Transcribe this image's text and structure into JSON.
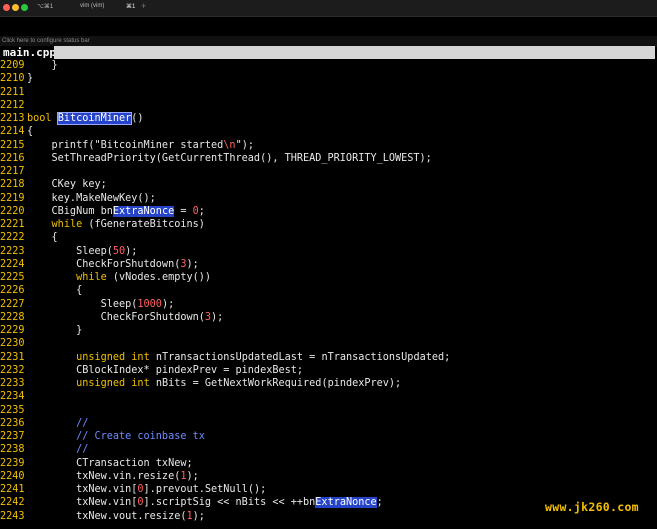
{
  "window": {
    "tab_left": "⌥⌘1",
    "tab_title": "vim (vim)",
    "tab_shortcut": "⌘1",
    "new_tab": "+"
  },
  "status_bar": {
    "hint": "Click here to configure status bar"
  },
  "file_tab": {
    "name": "main.cpp"
  },
  "editor": {
    "lines": [
      {
        "n": "2209",
        "code": "    }"
      },
      {
        "n": "2210",
        "code": "}"
      },
      {
        "n": "2211",
        "code": ""
      },
      {
        "n": "2212",
        "code": ""
      },
      {
        "n": "2213",
        "code": "bool BitcoinMiner()"
      },
      {
        "n": "2214",
        "code": "{"
      },
      {
        "n": "2215",
        "code": "    printf(\"BitcoinMiner started\\n\");"
      },
      {
        "n": "2216",
        "code": "    SetThreadPriority(GetCurrentThread(), THREAD_PRIORITY_LOWEST);"
      },
      {
        "n": "2217",
        "code": ""
      },
      {
        "n": "2218",
        "code": "    CKey key;"
      },
      {
        "n": "2219",
        "code": "    key.MakeNewKey();"
      },
      {
        "n": "2220",
        "code": "    CBigNum bnExtraNonce = 0;"
      },
      {
        "n": "2221",
        "code": "    while (fGenerateBitcoins)"
      },
      {
        "n": "2222",
        "code": "    {"
      },
      {
        "n": "2223",
        "code": "        Sleep(50);"
      },
      {
        "n": "2224",
        "code": "        CheckForShutdown(3);"
      },
      {
        "n": "2225",
        "code": "        while (vNodes.empty())"
      },
      {
        "n": "2226",
        "code": "        {"
      },
      {
        "n": "2227",
        "code": "            Sleep(1000);"
      },
      {
        "n": "2228",
        "code": "            CheckForShutdown(3);"
      },
      {
        "n": "2229",
        "code": "        }"
      },
      {
        "n": "2230",
        "code": ""
      },
      {
        "n": "2231",
        "code": "        unsigned int nTransactionsUpdatedLast = nTransactionsUpdated;"
      },
      {
        "n": "2232",
        "code": "        CBlockIndex* pindexPrev = pindexBest;"
      },
      {
        "n": "2233",
        "code": "        unsigned int nBits = GetNextWorkRequired(pindexPrev);"
      },
      {
        "n": "2234",
        "code": ""
      },
      {
        "n": "2235",
        "code": ""
      },
      {
        "n": "2236",
        "code": "        //"
      },
      {
        "n": "2237",
        "code": "        // Create coinbase tx"
      },
      {
        "n": "2238",
        "code": "        //"
      },
      {
        "n": "2239",
        "code": "        CTransaction txNew;"
      },
      {
        "n": "2240",
        "code": "        txNew.vin.resize(1);"
      },
      {
        "n": "2241",
        "code": "        txNew.vin[0].prevout.SetNull();"
      },
      {
        "n": "2242",
        "code": "        txNew.vin[0].scriptSig << nBits << ++bnExtraNonce;"
      },
      {
        "n": "2243",
        "code": "        txNew.vout.resize(1);"
      }
    ]
  },
  "watermark": "www.jk260.com",
  "colors": {
    "background": "#000000",
    "line_number": "#f0c000",
    "keyword": "#f0c000",
    "number": "#ff6060",
    "comment": "#6d8cff",
    "highlight": "#2644c9"
  }
}
